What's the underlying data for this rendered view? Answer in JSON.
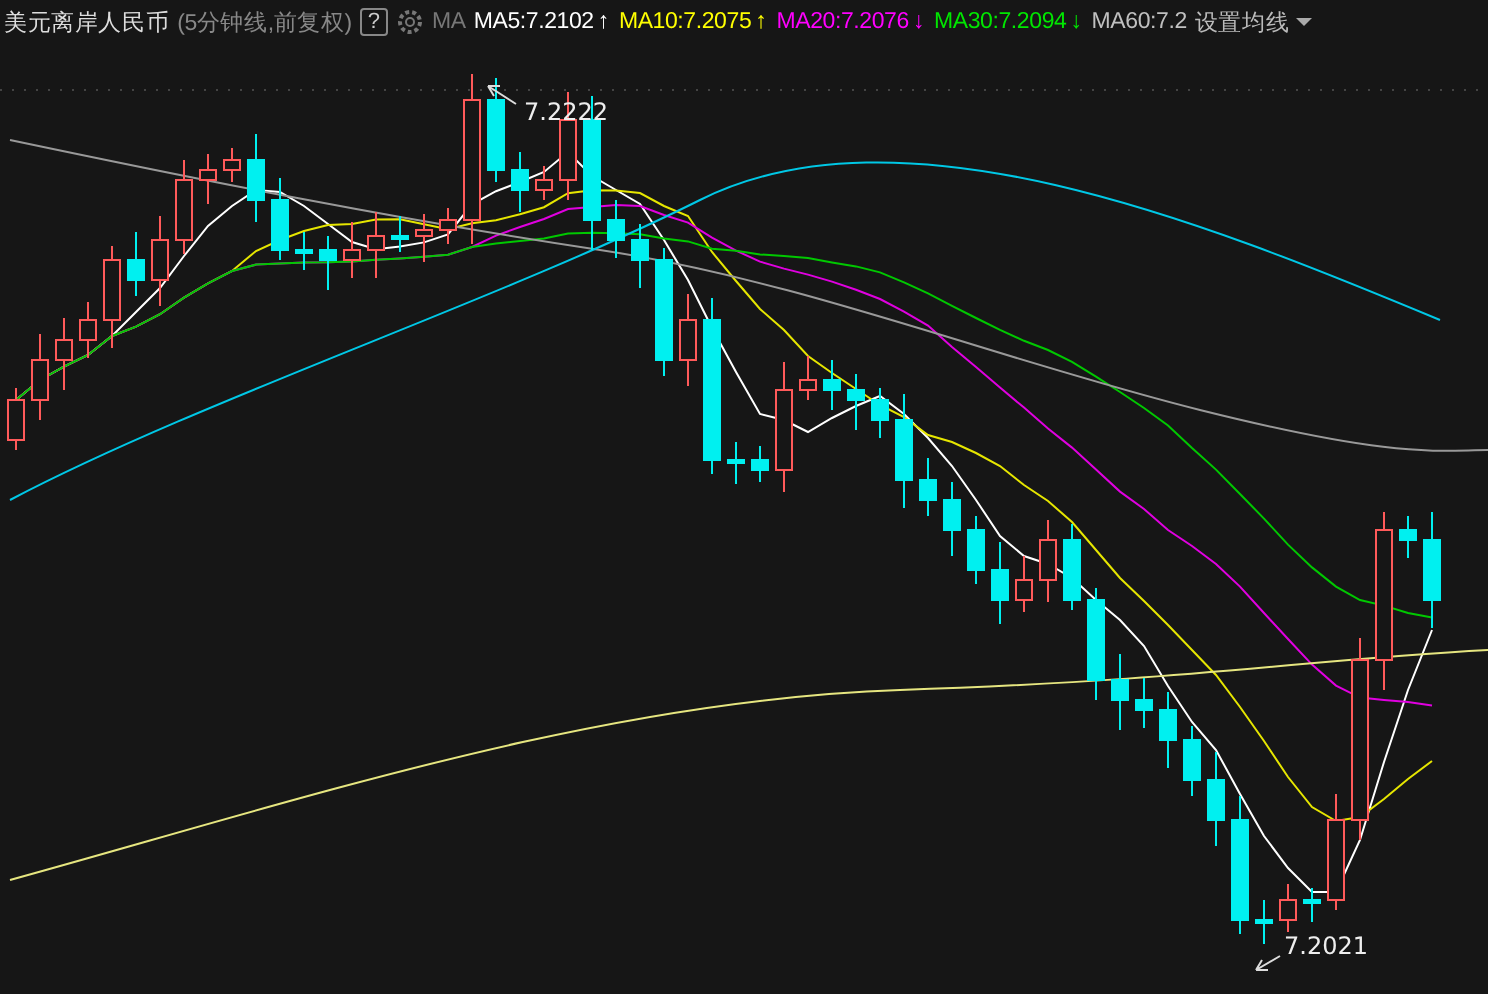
{
  "header": {
    "title": "美元离岸人民币",
    "subtitle": "(5分钟线,前复权)",
    "help": "?",
    "ma_label": "MA",
    "ma_items": [
      {
        "text": "MA5:7.2102",
        "arrow": "↑",
        "color": "#ffffff"
      },
      {
        "text": "MA10:7.2075",
        "arrow": "↑",
        "color": "#ffff00"
      },
      {
        "text": "MA20:7.2076",
        "arrow": "↓",
        "color": "#ff00ff"
      },
      {
        "text": "MA30:7.2094",
        "arrow": "↓",
        "color": "#00e600"
      },
      {
        "text": "MA60:7.2",
        "color": "#c0c0c0"
      }
    ],
    "settings": "设置均线"
  },
  "chart": {
    "high_label": "7.2222",
    "low_label": "7.2021"
  }
}
